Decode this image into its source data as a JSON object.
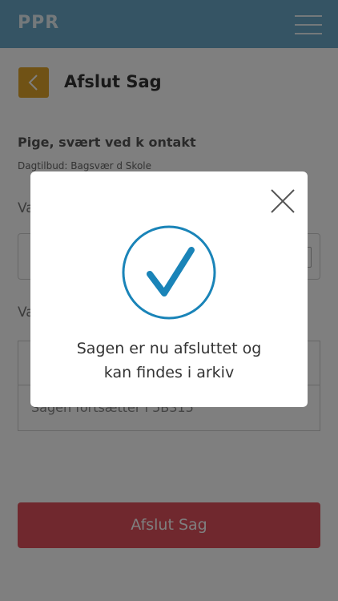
{
  "app": {
    "brand": "PPR"
  },
  "header": {
    "title": "Afslut Sag"
  },
  "case": {
    "name": "Pige, svært ved k ontakt",
    "subtitle": "Dagtilbud: Bagsvær d Skole"
  },
  "form": {
    "label_1": "Va",
    "label_2": "Va",
    "field_3_text": "Sagen fortsætter i 5B315",
    "submit_label": "Afslut Sag"
  },
  "modal": {
    "message_line1": "Sagen er nu afsluttet og",
    "message_line2": "kan findes i arkiv"
  },
  "colors": {
    "topbar": "#6aa8c8",
    "back_button": "#e0a52b",
    "submit_button": "#e0505c",
    "success_check": "#1a84b8"
  },
  "icons": [
    "menu-icon",
    "chevron-left-icon",
    "calendar-icon",
    "close-icon",
    "checkmark-circle-icon"
  ]
}
